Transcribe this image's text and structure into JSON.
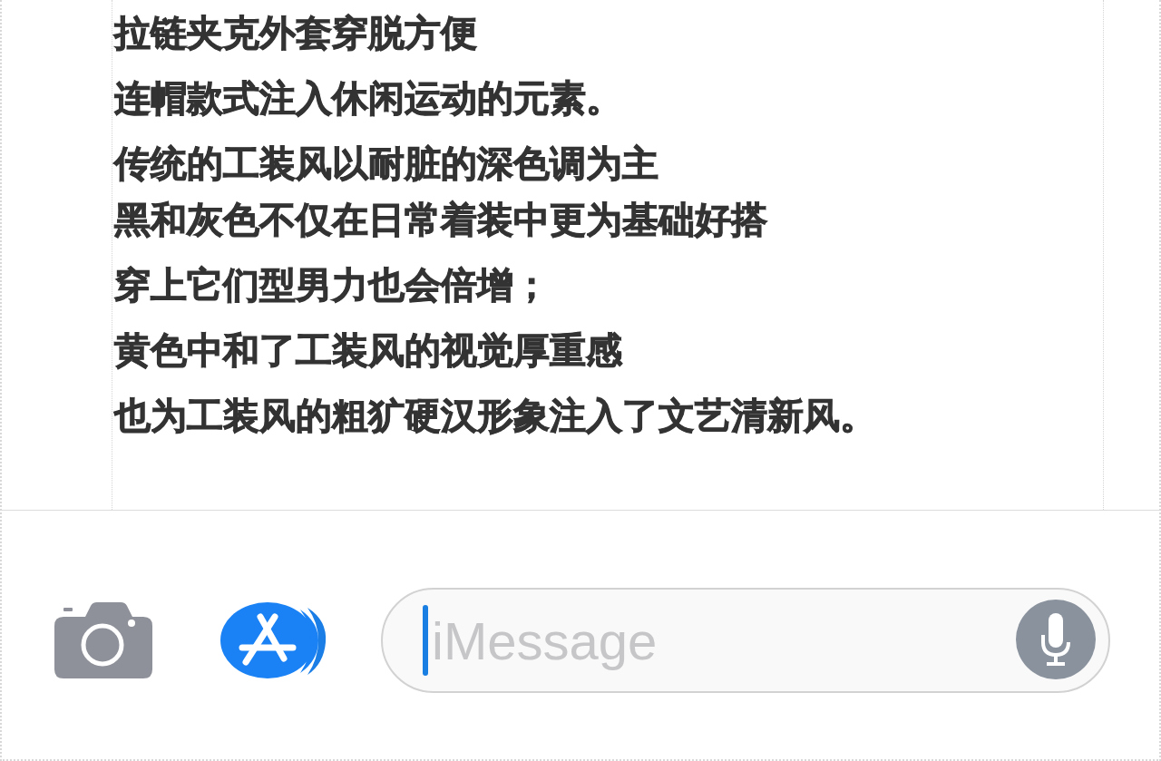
{
  "article": {
    "paragraphs": [
      {
        "lines": [
          "拉链夹克外套穿脱方便"
        ]
      },
      {
        "lines": [
          "连帽款式注入休闲运动的元素。"
        ]
      },
      {
        "lines": [
          "传统的工装风以耐脏的深色调为主",
          "黑和灰色不仅在日常着装中更为基础好搭"
        ]
      },
      {
        "lines": [
          "穿上它们型男力也会倍增；"
        ]
      },
      {
        "lines": [
          "黄色中和了工装风的视觉厚重感"
        ]
      },
      {
        "lines": [
          "也为工装风的粗犷硬汉形象注入了文艺清新风。"
        ]
      }
    ]
  },
  "compose_bar": {
    "message_field": {
      "placeholder": "iMessage",
      "focused": true
    }
  }
}
